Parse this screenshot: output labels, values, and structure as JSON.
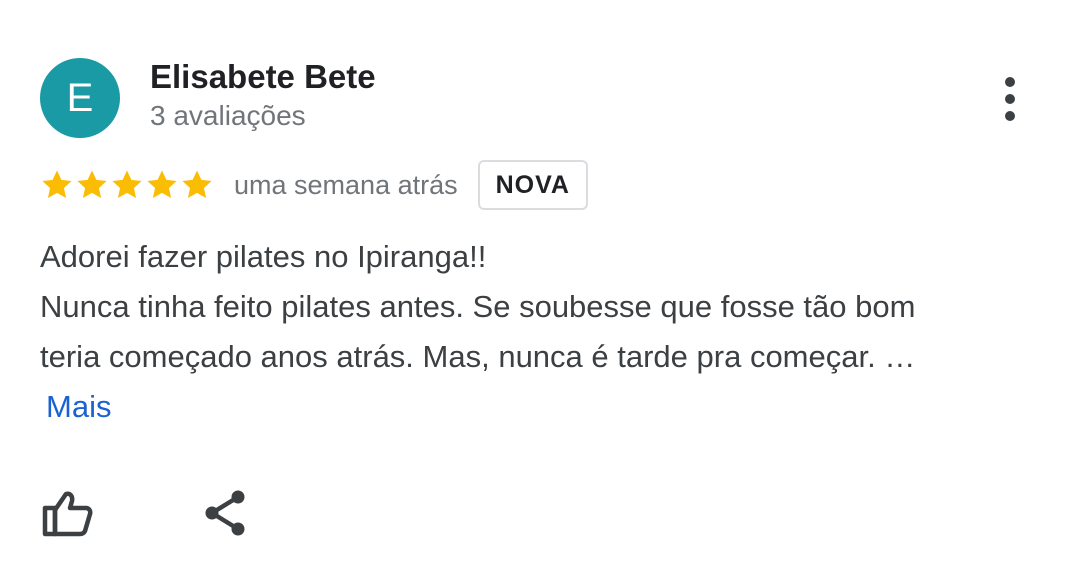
{
  "review": {
    "author": {
      "initial": "E",
      "name": "Elisabete Bete",
      "reviews_count_text": "3 avaliações",
      "avatar_color": "#1a9aa4"
    },
    "rating": {
      "stars": 5,
      "max_stars": 5,
      "star_color": "#fbbc04"
    },
    "time_ago": "uma semana atrás",
    "badge": "NOVA",
    "text_lines": [
      "Adorei fazer pilates no Ipiranga!!",
      "Nunca tinha feito pilates antes. Se soubesse que fosse tão bom",
      "teria começado anos atrás. Mas, nunca é tarde pra começar. …"
    ],
    "more_link": "Mais",
    "link_color": "#1a62d1"
  },
  "icons": {
    "menu": "more-vert-icon",
    "like": "thumb-up-icon",
    "share": "share-icon"
  }
}
